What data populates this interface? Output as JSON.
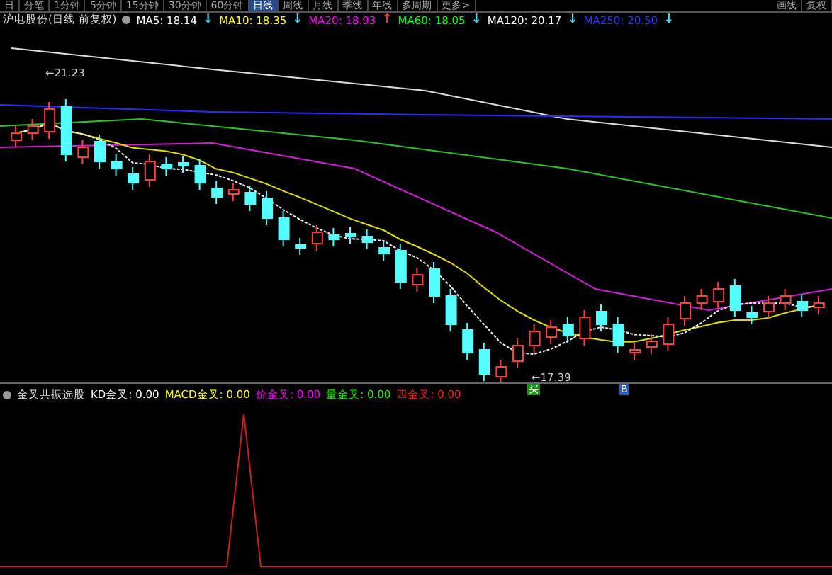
{
  "menu": [
    {
      "label": "日",
      "selected": false
    },
    {
      "label": "分笔",
      "selected": false
    },
    {
      "label": "1分钟",
      "selected": false
    },
    {
      "label": "5分钟",
      "selected": false
    },
    {
      "label": "15分钟",
      "selected": false
    },
    {
      "label": "30分钟",
      "selected": false
    },
    {
      "label": "60分钟",
      "selected": false
    },
    {
      "label": "日线",
      "selected": true
    },
    {
      "label": "周线",
      "selected": false
    },
    {
      "label": "月线",
      "selected": false
    },
    {
      "label": "季线",
      "selected": false
    },
    {
      "label": "年线",
      "selected": false
    },
    {
      "label": "多周期",
      "selected": false
    },
    {
      "label": "更多>",
      "selected": false
    }
  ],
  "menu_right": [
    {
      "label": "画线"
    },
    {
      "label": "复权"
    }
  ],
  "title": "沪电股份(日线 前复权)",
  "moving_averages": [
    {
      "name": "MA5:",
      "value": "18.14",
      "arrow": {
        "text": "↓",
        "color": "#40e0ff"
      },
      "color": "#ffffff"
    },
    {
      "name": "MA10:",
      "value": "18.35",
      "arrow": {
        "text": "↓",
        "color": "#40e0ff"
      },
      "color": "#ffff00"
    },
    {
      "name": "MA20:",
      "value": "18.93",
      "arrow": {
        "text": "↑",
        "color": "#ff3030"
      },
      "color": "#ff00ff"
    },
    {
      "name": "MA60:",
      "value": "18.05",
      "arrow": {
        "text": "↓",
        "color": "#40e0ff"
      },
      "color": "#00ff00"
    },
    {
      "name": "MA120:",
      "value": "20.17",
      "arrow": {
        "text": "↓",
        "color": "#40e0ff"
      },
      "color": "#ffffff"
    },
    {
      "name": "MA250:",
      "value": "20.50",
      "arrow": {
        "text": "↓",
        "color": "#40e0ff"
      },
      "color": "#3333ff"
    }
  ],
  "high_label": "←21.23",
  "low_label": "←17.39",
  "signals": [
    {
      "label": "买",
      "color": "#1e8f1e"
    },
    {
      "label": "B",
      "color": "#2a5db0"
    }
  ],
  "indicator": {
    "name": "金叉共振选股",
    "items": [
      {
        "name": "KD金叉:",
        "value": "0.00",
        "color": "#ffffff"
      },
      {
        "name": "MACD金叉:",
        "value": "0.00",
        "color": "#ffff00"
      },
      {
        "name": "价金叉:",
        "value": "0.00",
        "color": "#ff00ff"
      },
      {
        "name": "量金叉:",
        "value": "0.00",
        "color": "#00ff00"
      },
      {
        "name": "四金叉:",
        "value": "0.00",
        "color": "#ff2020"
      }
    ]
  }
}
